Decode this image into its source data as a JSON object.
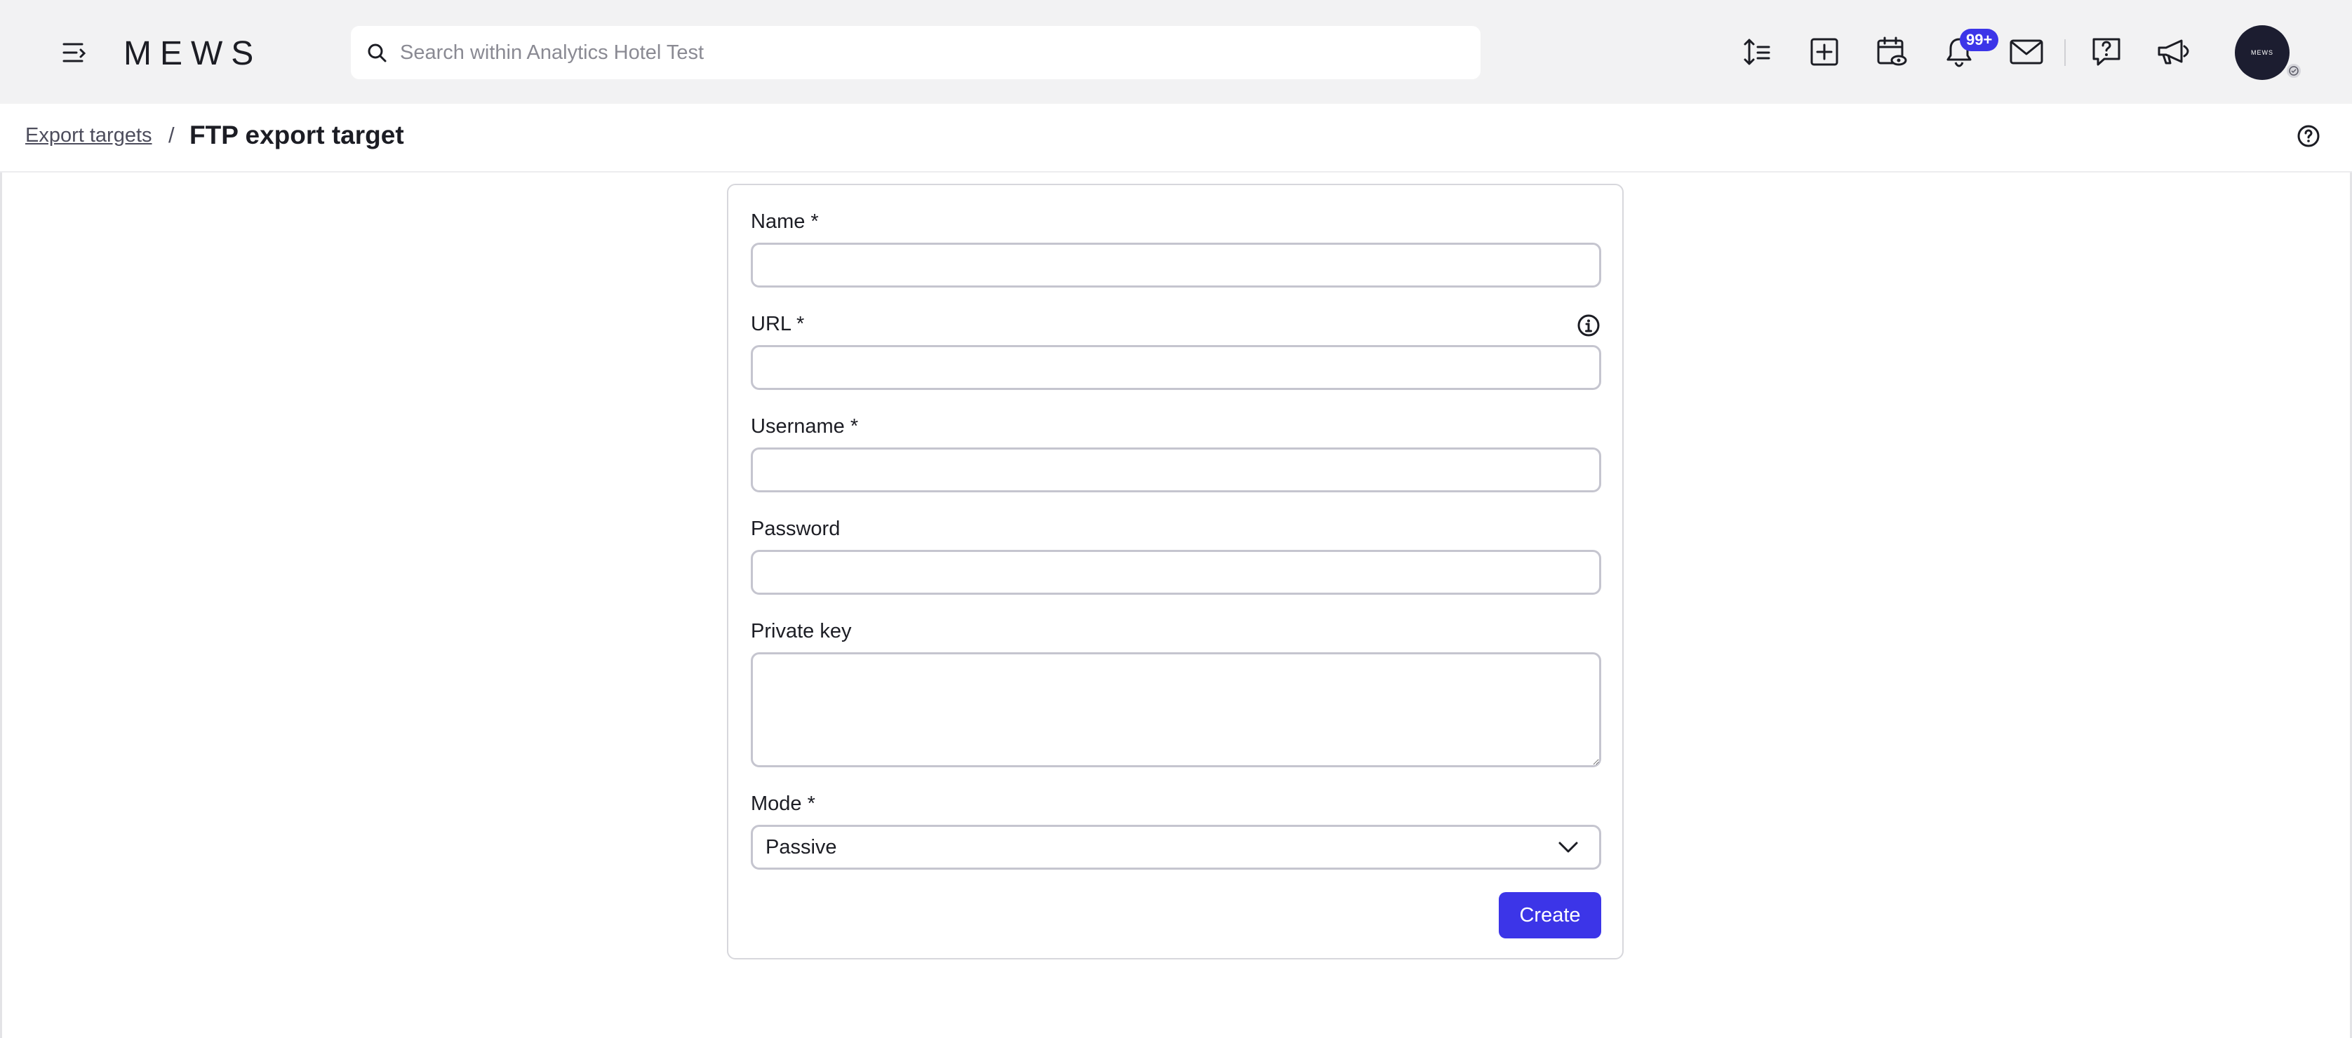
{
  "brand": {
    "logo_text": "MEWS",
    "accent": "#3c35e8"
  },
  "search": {
    "placeholder": "Search within Analytics Hotel Test"
  },
  "toolbar": {
    "icons": [
      "sort-icon",
      "add-icon",
      "calendar-view-icon",
      "bell-icon",
      "mail-icon",
      "help-chat-icon",
      "megaphone-icon"
    ],
    "notifications_badge": "99+"
  },
  "user": {
    "avatar_text": "MEWS"
  },
  "breadcrumb": {
    "parent": "Export targets",
    "separator": "/",
    "current": "FTP export target"
  },
  "form": {
    "name_label": "Name *",
    "url_label": "URL *",
    "username_label": "Username *",
    "password_label": "Password",
    "private_key_label": "Private key",
    "mode_label": "Mode *",
    "mode_value": "Passive",
    "submit_label": "Create"
  }
}
